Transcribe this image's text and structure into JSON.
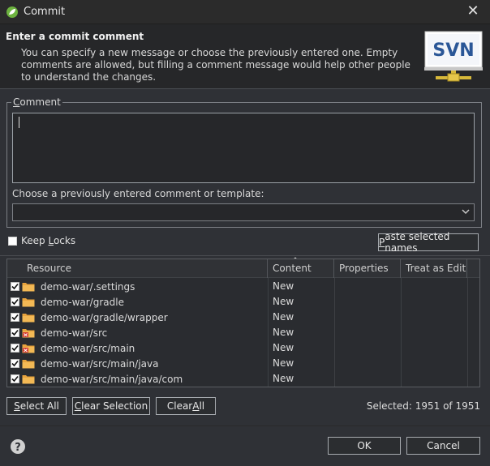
{
  "window": {
    "title": "Commit",
    "close_icon": "close-icon",
    "app_icon": "leaf-icon"
  },
  "banner": {
    "title": "Enter a commit comment",
    "description": "You can specify a new message or choose the previously entered one. Empty comments are allowed, but filling a comment message would help other people to understand the changes.",
    "logo_text": "SVN"
  },
  "comment": {
    "legend": "Comment",
    "value": "",
    "choose_label": "Choose a previously entered comment or template:",
    "template_selected": ""
  },
  "options": {
    "keep_locks_label": "Keep Locks",
    "keep_locks_checked": false,
    "paste_button": "Paste selected names"
  },
  "table": {
    "columns": [
      "Resource",
      "Content",
      "Properties",
      "Treat as Edit"
    ],
    "rows": [
      {
        "resource": "demo-war/.settings",
        "content": "New",
        "checked": true,
        "icon": "folder-icon"
      },
      {
        "resource": "demo-war/gradle",
        "content": "New",
        "checked": true,
        "icon": "folder-icon"
      },
      {
        "resource": "demo-war/gradle/wrapper",
        "content": "New",
        "checked": true,
        "icon": "folder-icon"
      },
      {
        "resource": "demo-war/src",
        "content": "New",
        "checked": true,
        "icon": "error-folder-icon"
      },
      {
        "resource": "demo-war/src/main",
        "content": "New",
        "checked": true,
        "icon": "error-folder-icon"
      },
      {
        "resource": "demo-war/src/main/java",
        "content": "New",
        "checked": true,
        "icon": "folder-icon"
      },
      {
        "resource": "demo-war/src/main/java/com",
        "content": "New",
        "checked": true,
        "icon": "folder-icon"
      }
    ]
  },
  "selection": {
    "select_all": "Select All",
    "clear_selection": "Clear Selection",
    "clear_all": "Clear All",
    "selected_text": "Selected: 1951 of 1951"
  },
  "footer": {
    "help_icon": "help-icon",
    "ok": "OK",
    "cancel": "Cancel"
  },
  "colors": {
    "background": "#2f3136",
    "banner": "#262729",
    "folder": "#e8a33d",
    "error": "#d43a2f"
  }
}
